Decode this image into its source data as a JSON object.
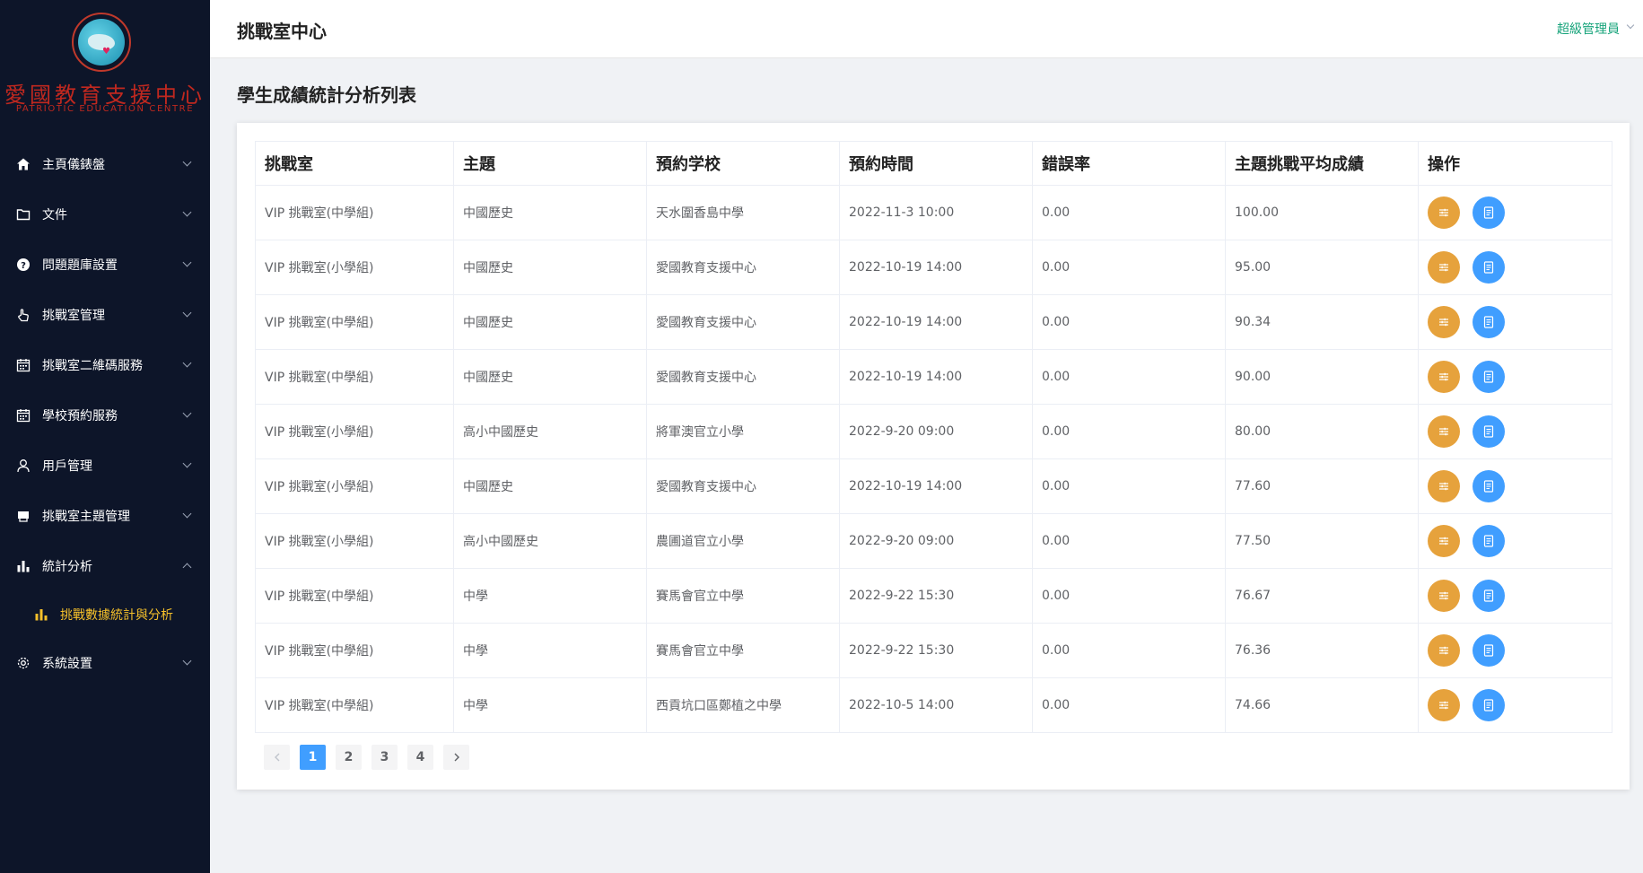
{
  "brand": {
    "name_cn": "愛國教育支援中心",
    "name_en": "PATRIOTIC EDUCATION CENTRE"
  },
  "menu": [
    {
      "label": "主頁儀錶盤",
      "icon": "home-icon"
    },
    {
      "label": "文件",
      "icon": "folder-icon"
    },
    {
      "label": "問題題庫設置",
      "icon": "question-icon"
    },
    {
      "label": "挑戰室管理",
      "icon": "hand-pointer-icon"
    },
    {
      "label": "挑戰室二維碼服務",
      "icon": "calendar-icon"
    },
    {
      "label": "學校預約服務",
      "icon": "calendar-icon"
    },
    {
      "label": "用戶管理",
      "icon": "user-icon"
    },
    {
      "label": "挑戰室主題管理",
      "icon": "box-icon"
    },
    {
      "label": "統計分析",
      "icon": "bar-chart-icon"
    }
  ],
  "submenu": {
    "label": "挑戰數據統計與分析",
    "icon": "bar-chart-icon"
  },
  "menu_last": {
    "label": "系統設置",
    "icon": "gear-icon"
  },
  "header": {
    "title": "挑戰室中心",
    "user": "超級管理員"
  },
  "page": {
    "title": "學生成績統計分析列表"
  },
  "table": {
    "columns": [
      "挑戰室",
      "主題",
      "預約学校",
      "預約時間",
      "錯誤率",
      "主題挑戰平均成績",
      "操作"
    ],
    "rows": [
      [
        "VIP 挑戰室(中學組)",
        "中國歷史",
        "天水圍香島中學",
        "2022-11-3 10:00",
        "0.00",
        "100.00"
      ],
      [
        "VIP 挑戰室(小學組)",
        "中國歷史",
        "愛國教育支援中心",
        "2022-10-19 14:00",
        "0.00",
        "95.00"
      ],
      [
        "VIP 挑戰室(中學組)",
        "中國歷史",
        "愛國教育支援中心",
        "2022-10-19 14:00",
        "0.00",
        "90.34"
      ],
      [
        "VIP 挑戰室(中學組)",
        "中國歷史",
        "愛國教育支援中心",
        "2022-10-19 14:00",
        "0.00",
        "90.00"
      ],
      [
        "VIP 挑戰室(小學組)",
        "高小中國歷史",
        "將軍澳官立小學",
        "2022-9-20 09:00",
        "0.00",
        "80.00"
      ],
      [
        "VIP 挑戰室(小學組)",
        "中國歷史",
        "愛國教育支援中心",
        "2022-10-19 14:00",
        "0.00",
        "77.60"
      ],
      [
        "VIP 挑戰室(小學組)",
        "高小中國歷史",
        "農圃道官立小學",
        "2022-9-20 09:00",
        "0.00",
        "77.50"
      ],
      [
        "VIP 挑戰室(中學組)",
        "中學",
        "賽馬會官立中學",
        "2022-9-22 15:30",
        "0.00",
        "76.67"
      ],
      [
        "VIP 挑戰室(中學組)",
        "中學",
        "賽馬會官立中學",
        "2022-9-22 15:30",
        "0.00",
        "76.36"
      ],
      [
        "VIP 挑戰室(中學組)",
        "中學",
        "西貢坑口區鄭植之中學",
        "2022-10-5 14:00",
        "0.00",
        "74.66"
      ]
    ],
    "action_icons": [
      "sliders-icon",
      "document-icon"
    ]
  },
  "pagination": {
    "pages": [
      "1",
      "2",
      "3",
      "4"
    ],
    "current": "1"
  },
  "colors": {
    "sidebar_bg": "#0d1529",
    "active_submenu": "#f5c02a",
    "user_link": "#16a37a",
    "btn_orange": "#e6a23c",
    "btn_blue": "#409eff"
  }
}
